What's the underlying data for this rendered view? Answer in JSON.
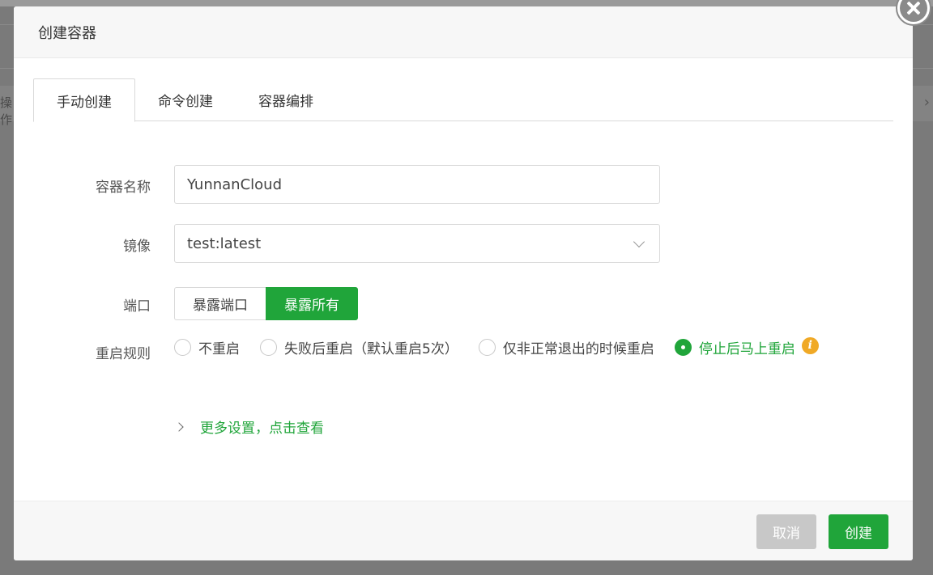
{
  "background": {
    "side_text": "操作",
    "right_arrow": "›"
  },
  "modal": {
    "title": "创建容器"
  },
  "tabs": [
    {
      "label": "手动创建",
      "active": true
    },
    {
      "label": "命令创建",
      "active": false
    },
    {
      "label": "容器编排",
      "active": false
    }
  ],
  "form": {
    "name_label": "容器名称",
    "name_value": "YunnanCloud",
    "image_label": "镜像",
    "image_value": "test:latest",
    "port_label": "端口",
    "port_options": [
      "暴露端口",
      "暴露所有"
    ],
    "port_selected": "暴露所有",
    "restart_label": "重启规则",
    "restart_options": [
      "不重启",
      "失败后重启（默认重启5次）",
      "仅非正常退出的时候重启",
      "停止后马上重启"
    ],
    "restart_selected": "停止后马上重启",
    "more_settings": "更多设置，点击查看"
  },
  "footer": {
    "cancel_label": "取消",
    "create_label": "创建"
  },
  "colors": {
    "accent": "#20a53a",
    "info": "#f0a926",
    "cancel": "#c8c8c8"
  },
  "icons": {
    "close": "close-icon",
    "select": "chevron-down-icon",
    "info": "info-icon",
    "expand": "chevron-right-icon"
  }
}
